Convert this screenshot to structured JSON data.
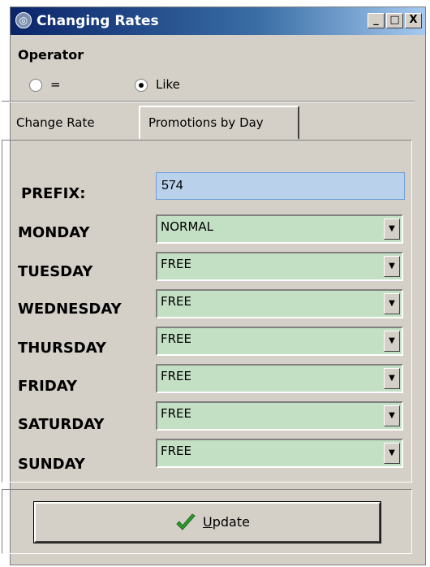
{
  "window": {
    "title": "Changing Rates",
    "icon": "app-globe-icon",
    "controls": {
      "minimize": "_",
      "maximize": "□",
      "close": "X"
    }
  },
  "operator": {
    "label": "Operator",
    "options": [
      {
        "label": "=",
        "selected": false
      },
      {
        "label": "Like",
        "selected": true
      }
    ]
  },
  "tabs": [
    {
      "label": "Change Rate",
      "active": false
    },
    {
      "label": "Promotions by Day",
      "active": true
    }
  ],
  "form": {
    "prefix_label": "PREFIX:",
    "prefix_value": "574",
    "days": [
      {
        "label": "MONDAY",
        "value": "NORMAL"
      },
      {
        "label": "TUESDAY",
        "value": "FREE"
      },
      {
        "label": "WEDNESDAY",
        "value": "FREE"
      },
      {
        "label": "THURSDAY",
        "value": "FREE"
      },
      {
        "label": "FRIDAY",
        "value": "FREE"
      },
      {
        "label": "SATURDAY",
        "value": "FREE"
      },
      {
        "label": "SUNDAY",
        "value": "FREE"
      }
    ],
    "dropdown_arrow": "▼"
  },
  "actions": {
    "update_label": "Update",
    "update_icon": "checkmark-icon"
  },
  "colors": {
    "titlebar": "#0a246a",
    "window_bg": "#d4d0c8",
    "select_bg": "#c3dfc4",
    "prefix_bg": "#b9d1ea",
    "check_green": "#2f9a2f"
  }
}
